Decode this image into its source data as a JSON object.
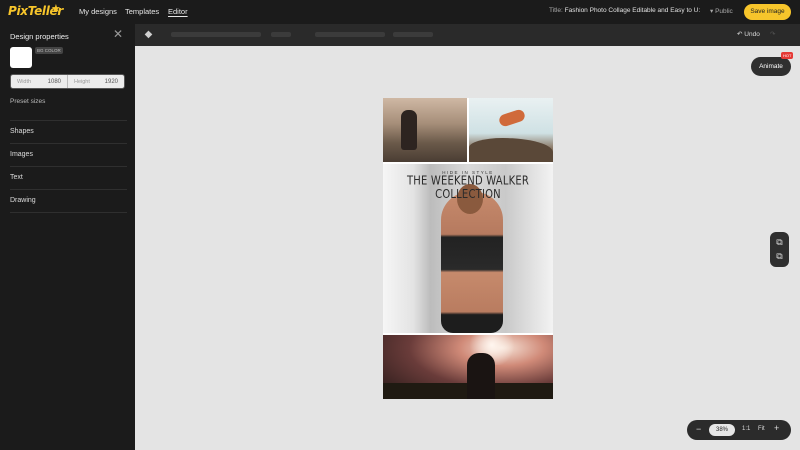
{
  "app": {
    "logo": "PixTeller"
  },
  "nav": [
    {
      "label": "My designs"
    },
    {
      "label": "Templates"
    },
    {
      "label": "Editor",
      "active": true
    }
  ],
  "header": {
    "title_label": "Title:",
    "title_value": "Fashion Photo Collage Editable and Easy to U:",
    "visibility": "Public",
    "save_label": "Save image"
  },
  "sidebar": {
    "title": "Design properties",
    "bg_color_tag": "BG COLOR",
    "bg_color": "#ffffff",
    "width_label": "Width",
    "width_value": "1080",
    "height_label": "Height",
    "height_value": "1920",
    "preset_label": "Preset sizes",
    "items": [
      {
        "label": "Shapes"
      },
      {
        "label": "Images"
      },
      {
        "label": "Text"
      },
      {
        "label": "Drawing"
      }
    ]
  },
  "toolbar": {
    "undo_label": "Undo",
    "redo_label": "Redo"
  },
  "canvas": {
    "overlay_small": "HIDE IN STYLE",
    "overlay_title": "THE WEEKEND WALKER COLLECTION"
  },
  "right_panel": {
    "animate_label": "Animate",
    "hot_badge": "HOT"
  },
  "zoom": {
    "value": "38%",
    "ratio": "1:1",
    "fit": "Fit"
  },
  "colors": {
    "accent": "#f7c52b",
    "dark": "#1b1b1b",
    "hot": "#e53935"
  }
}
